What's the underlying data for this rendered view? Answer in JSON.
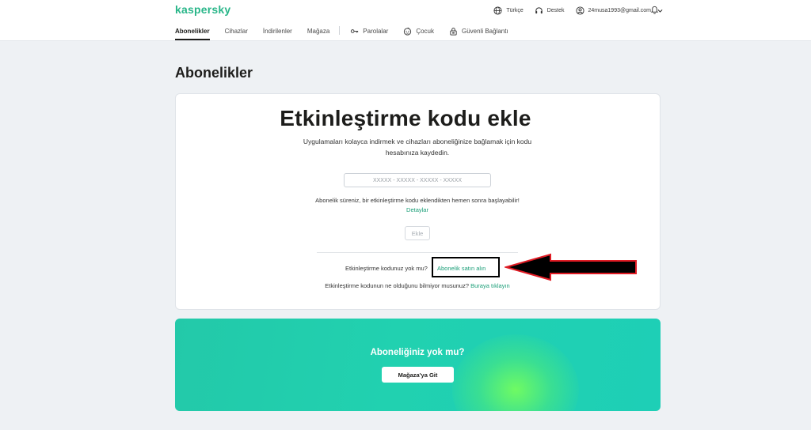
{
  "header": {
    "logo": "kaspersky",
    "language": "Türkçe",
    "support": "Destek",
    "account_email": "24musa1993@gmail.com"
  },
  "nav": {
    "items": [
      {
        "label": "Abonelikler"
      },
      {
        "label": "Cihazlar"
      },
      {
        "label": "İndirilenler"
      },
      {
        "label": "Mağaza"
      }
    ],
    "extra": [
      {
        "label": "Parolalar",
        "icon": "key-icon"
      },
      {
        "label": "Çocuk",
        "icon": "child-face-icon"
      },
      {
        "label": "Güvenli Bağlantı",
        "icon": "lock-icon"
      }
    ]
  },
  "page": {
    "title": "Abonelikler"
  },
  "card": {
    "title": "Etkinleştirme kodu ekle",
    "subtitle": "Uygulamaları kolayca indirmek ve cihazları aboneliğinize bağlamak için kodu hesabınıza kaydedin.",
    "code_placeholder": "XXXXX - XXXXX - XXXXX - XXXXX",
    "info_text": "Abonelik süreniz, bir etkinleştirme kodu eklendikten hemen sonra başlayabilir!",
    "info_link": "Detaylar",
    "add_button": "Ekle",
    "no_code_text": "Etkinleştirme kodunuz yok mu?",
    "buy_link": "Abonelik satın alın",
    "what_text": "Etkinleştirme kodunun ne olduğunu bilmiyor musunuz?",
    "what_link": "Buraya tıklayın"
  },
  "banner": {
    "title": "Aboneliğiniz yok mu?",
    "button": "Mağaza'ya Git"
  },
  "colors": {
    "accent": "#1a9e77",
    "logo": "#29b689",
    "arrow": "#e01b24",
    "banner": "#21d1b0"
  }
}
